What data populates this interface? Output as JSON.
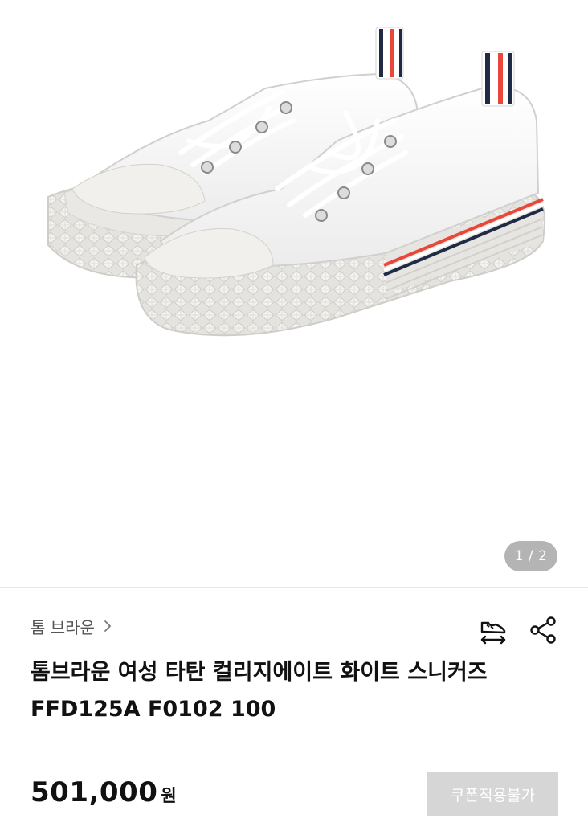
{
  "gallery": {
    "image_alt": "white canvas low-top sneakers pair with tricolor stripe",
    "indicator": "1 / 2",
    "colors": {
      "stripe_red": "#e8473a",
      "stripe_navy": "#1f2a44",
      "stripe_white": "#ffffff"
    }
  },
  "product": {
    "brand_label": "톰 브라운",
    "title_line1": "톰브라운 여성 타탄 컬리지에이트 화이트 스니커즈",
    "title_line2": "FFD125A F0102 100",
    "price": "501,000",
    "currency": "원"
  },
  "actions": {
    "size_icon": "shoe-size-icon",
    "share_icon": "share-icon",
    "coupon_label": "쿠폰적용불가"
  }
}
